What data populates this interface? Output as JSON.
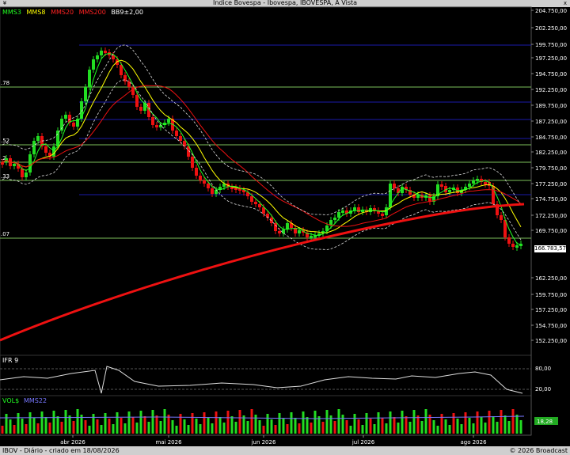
{
  "window": {
    "title": "Indice Bovespa - Ibovespa, IBOVESPA, A Vista",
    "menu_glyph": "¥",
    "close_glyph": "x"
  },
  "legend": [
    {
      "label": "MMS3",
      "color": "#22ff22"
    },
    {
      "label": "MMS8",
      "color": "#ffff00"
    },
    {
      "label": "MMS20",
      "color": "#ff2222"
    },
    {
      "label": "MMS200",
      "color": "#ff2222"
    },
    {
      "label": "BB9±2,00",
      "color": "#ffffff"
    }
  ],
  "price_axis_labels": [
    "204.750,00",
    "202.250,00",
    "199.750,00",
    "197.250,00",
    "194.750,00",
    "192.250,00",
    "189.750,00",
    "187.250,00",
    "184.750,00",
    "182.250,00",
    "179.750,00",
    "177.250,00",
    "174.750,00",
    "172.250,00",
    "169.750,00",
    "166.783,57",
    "162.250,00",
    "159.750,00",
    "157.250,00",
    "154.750,00",
    "152.250,00"
  ],
  "left_level_labels": [
    ".78",
    ".52",
    ".2",
    ".33",
    ".07"
  ],
  "current_price": "166.783,57",
  "ifr": {
    "label": "IFR 9",
    "levels": [
      "80,00",
      "20,00"
    ]
  },
  "volume": {
    "label": "VOL$",
    "ma_label": "MMS22",
    "value_label": "18,28"
  },
  "months": [
    "abr 2026",
    "mai 2026",
    "jun 2026",
    "jul 2026",
    "ago 2026"
  ],
  "footer": {
    "left": "IBOV - Diário - criado em 18/08/2026",
    "right": "© 2026 Broadcast"
  },
  "colors": {
    "up": "#22dd22",
    "down": "#ee1111",
    "blue_lines": "#1a1aaa",
    "green_lines": "#7dbf5a"
  }
}
